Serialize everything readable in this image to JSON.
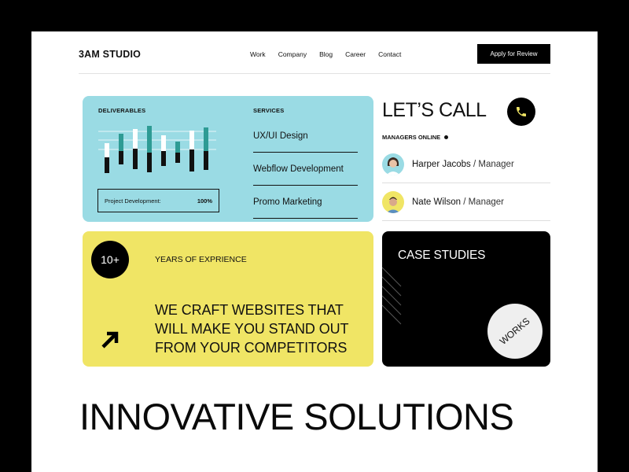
{
  "header": {
    "logo": "3AM STUDIO",
    "nav": [
      "Work",
      "Company",
      "Blog",
      "Career",
      "Contact"
    ],
    "cta": "Apply for Review"
  },
  "deliverables": {
    "label": "DELIVERABLES",
    "project_label": "Project Development:",
    "project_value": "100%",
    "colors": {
      "card": "#9adbe4",
      "bar_dark": "#111111",
      "bar_teal": "#2e9b94",
      "bar_white": "#ffffff"
    }
  },
  "services": {
    "label": "SERVICES",
    "items": [
      "UX/UI Design",
      "Webflow Development",
      "Promo Marketing"
    ]
  },
  "call": {
    "title": "LET’S CALL",
    "online_label": "MANAGERS ONLINE",
    "managers": [
      {
        "name": "Harper Jacobs",
        "role": "Manager"
      },
      {
        "name": "Nate Wilson",
        "role": "Manager"
      }
    ]
  },
  "experience": {
    "badge": "10+",
    "label": "YEARS OF EXPRIENCE",
    "headline_lines": [
      "WE CRAFT WEBSITES THAT",
      "WILL MAKE YOU STAND OUT",
      "FROM YOUR COMPETITORS"
    ],
    "color": "#f0e565"
  },
  "case_studies": {
    "title": "CASE STUDIES",
    "badge": "WORKS"
  },
  "hero": {
    "text": "INNOVATIVE SOLUTIONS"
  }
}
